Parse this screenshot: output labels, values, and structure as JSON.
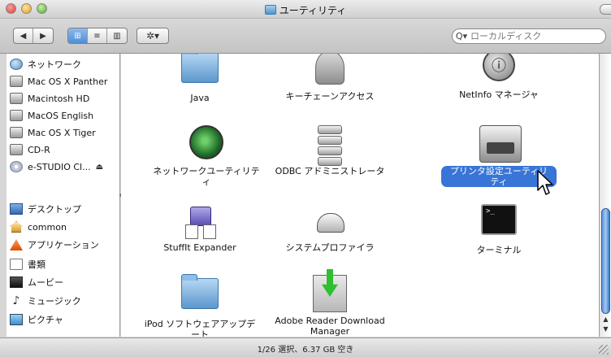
{
  "window": {
    "title": "ユーティリティ"
  },
  "toolbar": {
    "back_icon": "◀",
    "forward_icon": "▶",
    "view_icon_label": "⊞",
    "view_list_label": "≡",
    "view_column_label": "▥",
    "action_label": "✲▾",
    "search_placeholder": "ローカルディスク"
  },
  "sidebar": {
    "items": [
      {
        "label": "ネットワーク",
        "icon": "network-icon"
      },
      {
        "label": "Mac OS X Panther",
        "icon": "hard-disk-icon"
      },
      {
        "label": "Macintosh HD",
        "icon": "hard-disk-icon"
      },
      {
        "label": "MacOS English",
        "icon": "hard-disk-icon"
      },
      {
        "label": "Mac OS X Tiger",
        "icon": "hard-disk-icon"
      },
      {
        "label": "CD-R",
        "icon": "hard-disk-icon"
      },
      {
        "label": "e-STUDIO Cl...",
        "icon": "cd-icon",
        "eject": "⏏"
      },
      {
        "label": "デスクトップ",
        "icon": "desktop-icon"
      },
      {
        "label": "common",
        "icon": "home-icon"
      },
      {
        "label": "アプリケーション",
        "icon": "applications-icon"
      },
      {
        "label": "書類",
        "icon": "documents-icon"
      },
      {
        "label": "ムービー",
        "icon": "movies-icon"
      },
      {
        "label": "ミュージック",
        "icon": "music-icon"
      },
      {
        "label": "ピクチャ",
        "icon": "pictures-icon"
      }
    ]
  },
  "content": {
    "items": [
      {
        "label": "Java",
        "icon": "folder-icon"
      },
      {
        "label": "キーチェーンアクセス",
        "icon": "keychain-icon"
      },
      {
        "label": "NetInfo マネージャ",
        "icon": "netinfo-icon"
      },
      {
        "label": "ネットワークユーティリティ",
        "icon": "network-utility-icon"
      },
      {
        "label": "ODBC アドミニストレータ",
        "icon": "database-icon"
      },
      {
        "label": "プリンタ設定ユーティリティ",
        "icon": "printer-icon",
        "selected": true
      },
      {
        "label": "StuffIt Expander",
        "icon": "stuffit-icon"
      },
      {
        "label": "システムプロファイラ",
        "icon": "system-profiler-icon"
      },
      {
        "label": "ターミナル",
        "icon": "terminal-icon"
      },
      {
        "label": "iPod ソフトウェアアップデート",
        "icon": "folder-icon"
      },
      {
        "label": "Adobe Reader Download Manager",
        "icon": "download-icon"
      }
    ]
  },
  "status": {
    "text": "1/26 選択、6.37 GB 空き"
  },
  "colors": {
    "selection": "#3875d7",
    "scroll_thumb": "#5b95dc"
  }
}
